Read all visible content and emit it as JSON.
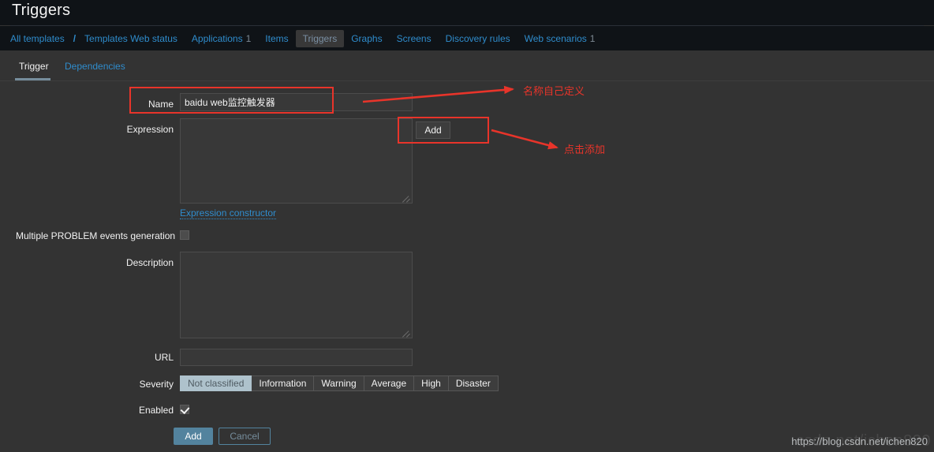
{
  "header": {
    "title": "Triggers"
  },
  "nav": {
    "items": [
      {
        "label": "All templates",
        "count": "",
        "selected": false
      },
      {
        "label": "Templates Web status",
        "count": "",
        "selected": false
      },
      {
        "label": "Applications",
        "count": "1",
        "selected": false
      },
      {
        "label": "Items",
        "count": "",
        "selected": false
      },
      {
        "label": "Triggers",
        "count": "",
        "selected": true
      },
      {
        "label": "Graphs",
        "count": "",
        "selected": false
      },
      {
        "label": "Screens",
        "count": "",
        "selected": false
      },
      {
        "label": "Discovery rules",
        "count": "",
        "selected": false
      },
      {
        "label": "Web scenarios",
        "count": "1",
        "selected": false
      }
    ],
    "separator": "/"
  },
  "tabs": {
    "active": "Trigger",
    "inactive": "Dependencies"
  },
  "form": {
    "name": {
      "label": "Name",
      "value": "baidu web监控触发器",
      "placeholder": ""
    },
    "expression": {
      "label": "Expression",
      "value": "",
      "placeholder": "",
      "add_button": "Add",
      "constructor_link": "Expression constructor"
    },
    "multiple_problem": {
      "label": "Multiple PROBLEM events generation",
      "checked": false
    },
    "description": {
      "label": "Description",
      "value": "",
      "placeholder": ""
    },
    "url": {
      "label": "URL",
      "value": "",
      "placeholder": ""
    },
    "severity": {
      "label": "Severity",
      "options": [
        "Not classified",
        "Information",
        "Warning",
        "Average",
        "High",
        "Disaster"
      ],
      "selected": "Not classified"
    },
    "enabled": {
      "label": "Enabled",
      "checked": true
    },
    "footer": {
      "submit": "Add",
      "cancel": "Cancel"
    }
  },
  "annotations": {
    "name_note": "名称自己定义",
    "add_note": "点击添加",
    "accent_color": "#e8342a"
  },
  "watermark": {
    "url": "https://blog.csdn.net/ichen820",
    "ghost": "csdn.net/ichen820"
  },
  "theme": {
    "header_bg": "#0f1317",
    "content_bg": "#333333",
    "link": "#2f8ccc",
    "text": "#f2f2f2",
    "input_bg": "#383838",
    "primary": "#53839e",
    "selected_seg": "#aec2cc"
  }
}
